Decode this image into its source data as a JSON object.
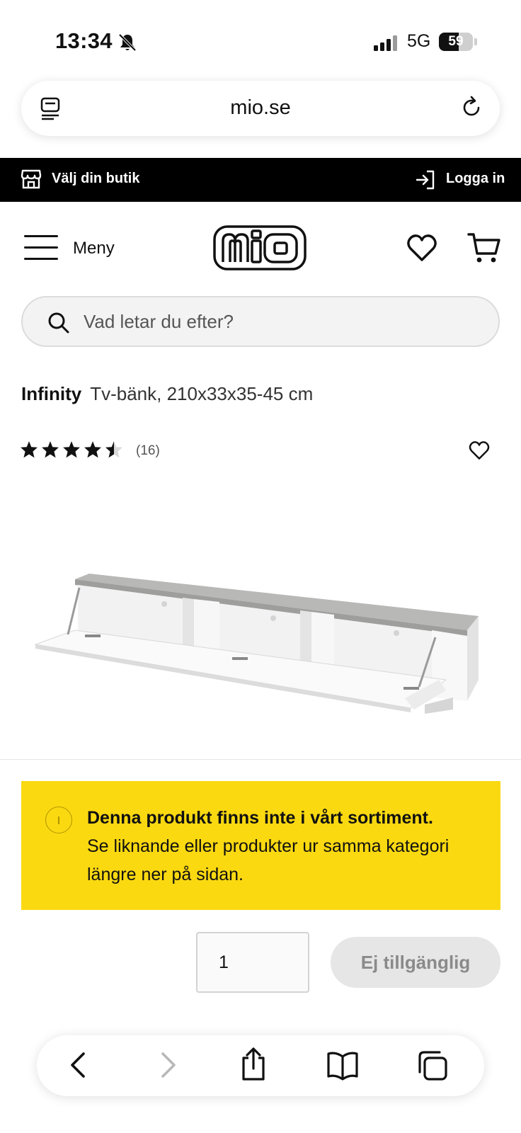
{
  "status_bar": {
    "time": "13:34",
    "network": "5G",
    "battery": "59",
    "battery_level": 59
  },
  "browser": {
    "url": "mio.se"
  },
  "top_strip": {
    "store_label": "Välj din butik",
    "login_label": "Logga in"
  },
  "header": {
    "menu_label": "Meny",
    "logo_text": "mio"
  },
  "search": {
    "placeholder": "Vad letar du efter?"
  },
  "product": {
    "brand": "Infinity",
    "description": "Tv-bänk, 210x33x35-45 cm",
    "rating": 4.5,
    "rating_max": 5,
    "review_count": "(16)"
  },
  "notice": {
    "title": "Denna produkt finns inte i vårt sortiment.",
    "body": "Se liknande eller produkter ur samma kategori längre ner på sidan."
  },
  "purchase": {
    "quantity": "1",
    "button_label": "Ej tillgänglig"
  },
  "icons": {
    "status": [
      "bell-slash-icon",
      "signal-icon",
      "battery-icon"
    ],
    "browser": [
      "tab-overview-icon",
      "reload-icon"
    ],
    "toolbar": [
      "back-icon",
      "forward-icon",
      "share-icon",
      "bookmarks-icon",
      "tabs-icon"
    ]
  },
  "colors": {
    "notice_bg": "#fbd911",
    "strip_bg": "#000000",
    "button_disabled_bg": "#e6e6e6"
  }
}
